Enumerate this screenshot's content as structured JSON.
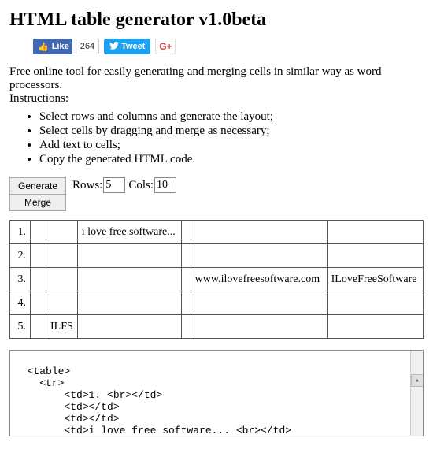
{
  "header": {
    "title": "HTML table generator v1.0beta"
  },
  "social": {
    "fb_like_label": "Like",
    "fb_like_count": "264",
    "tweet_label": "Tweet",
    "gplus_label": "G+"
  },
  "intro": {
    "line1": "Free online tool for easily generating and merging cells in similar way as word processors.",
    "line2": "Instructions:"
  },
  "instructions": [
    "Select rows and columns and generate the layout;",
    "Select cells by dragging and merge as necessary;",
    "Add text to cells;",
    "Copy the generated HTML code."
  ],
  "controls": {
    "generate_label": "Generate",
    "merge_label": "Merge",
    "rows_label": "Rows:",
    "rows_value": "5",
    "cols_label": "Cols:",
    "cols_value": "10"
  },
  "table": {
    "rows": [
      {
        "num": "1.",
        "cells": [
          "",
          "",
          "i love free software...",
          "",
          "",
          ""
        ]
      },
      {
        "num": "2.",
        "cells": [
          "",
          "",
          "",
          "",
          "",
          ""
        ]
      },
      {
        "num": "3.",
        "cells": [
          "",
          "",
          "",
          "",
          "www.ilovefreesoftware.com",
          "ILoveFreeSoftware"
        ]
      },
      {
        "num": "4.",
        "cells": [
          "",
          "",
          "",
          "",
          "",
          ""
        ]
      },
      {
        "num": "5.",
        "cells": [
          "",
          "ILFS",
          "",
          "",
          "",
          ""
        ]
      }
    ]
  },
  "code_output": "<table>\n    <tr>\n        <td>1. <br></td>\n        <td></td>\n        <td></td>\n        <td>i love free software... <br></td>\n        <td></td>"
}
